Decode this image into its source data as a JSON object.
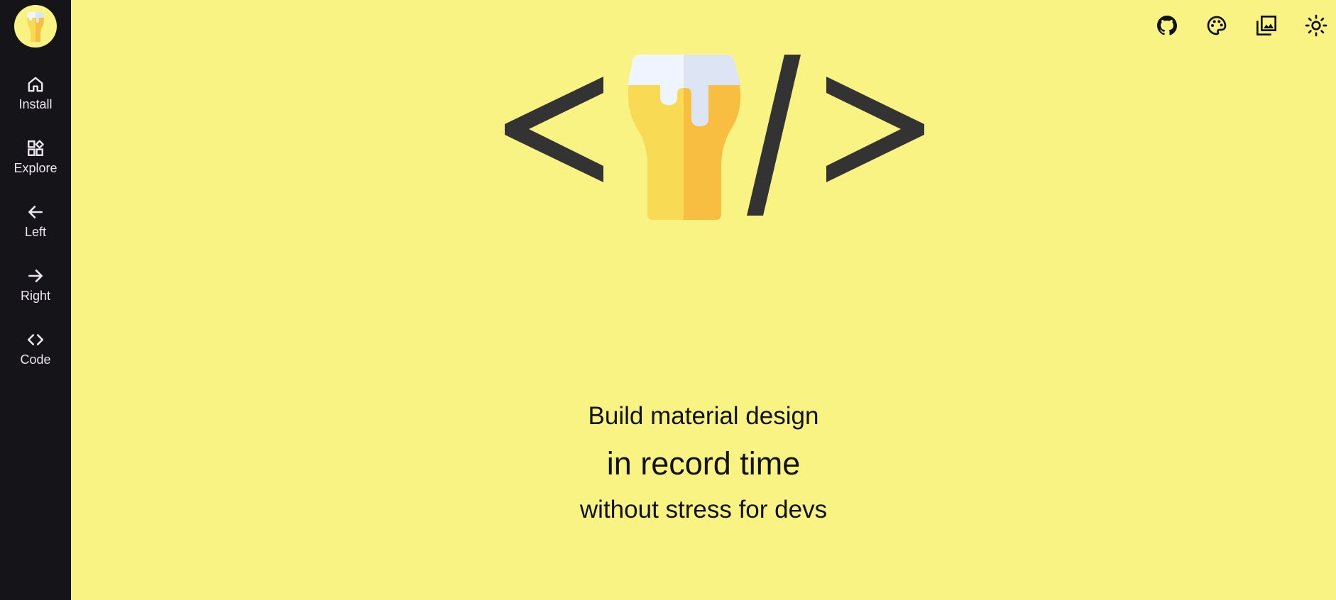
{
  "sidebar": {
    "logo_icon": "beer-glass-icon",
    "items": [
      {
        "label": "Install",
        "icon": "home-icon"
      },
      {
        "label": "Explore",
        "icon": "widgets-icon"
      },
      {
        "label": "Left",
        "icon": "arrow-left-icon"
      },
      {
        "label": "Right",
        "icon": "arrow-right-icon"
      },
      {
        "label": "Code",
        "icon": "code-icon"
      }
    ]
  },
  "toolbar": {
    "icons": [
      "github-icon",
      "palette-icon",
      "photo-library-icon",
      "light-mode-icon"
    ]
  },
  "hero": {
    "glyph_left": "<",
    "glyph_slash": "/",
    "glyph_right": ">",
    "icon": "beer-glass-icon"
  },
  "headline": {
    "line1": "Build material design",
    "line2": "in record time",
    "line3": "without stress for devs"
  },
  "colors": {
    "background": "#F9F383",
    "sidebar": "#151418",
    "sidebar_text": "#ECE6F0",
    "glyph": "#333333",
    "beer_light": "#F9DA55",
    "beer_dark": "#F7BE42",
    "foam_light": "#EFF5FF",
    "foam_dark": "#DDE4F4"
  }
}
